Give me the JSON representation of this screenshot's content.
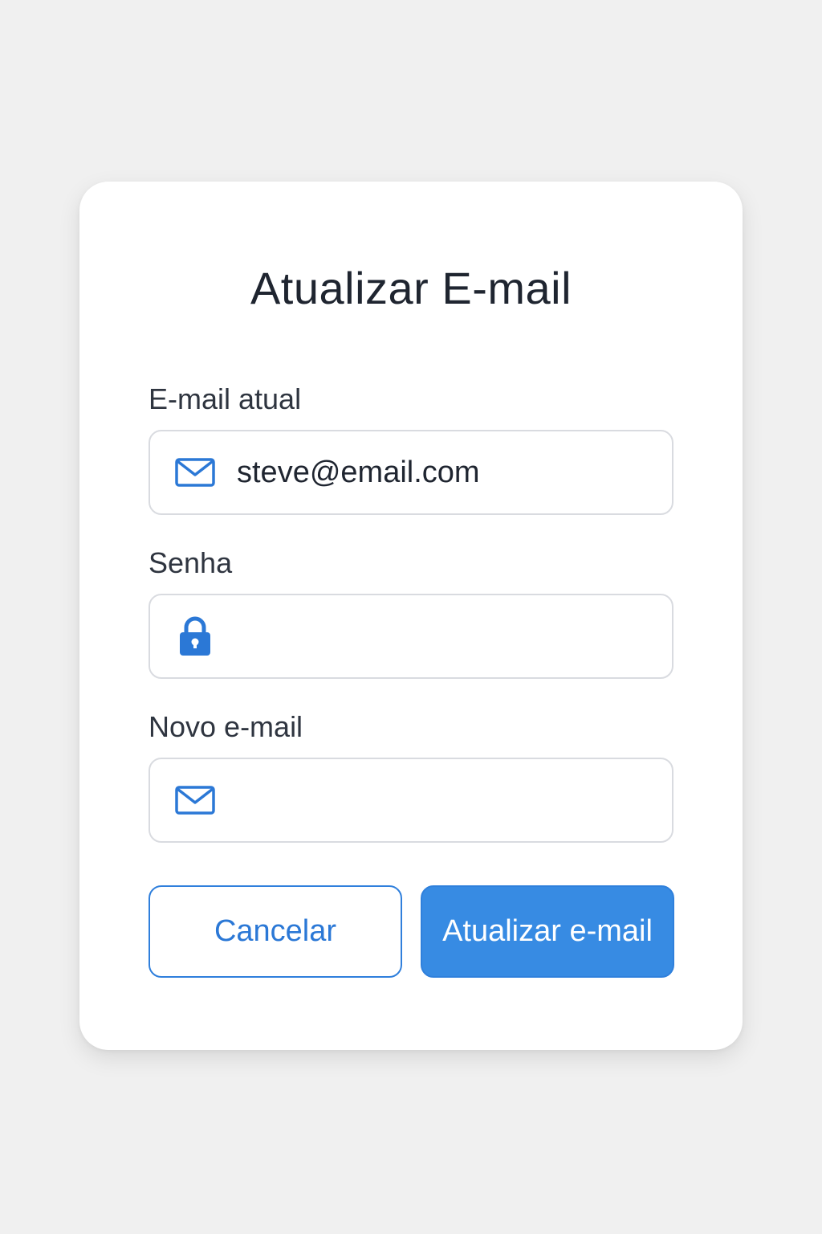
{
  "dialog": {
    "title": "Atualizar E-mail"
  },
  "fields": {
    "current_email": {
      "label": "E-mail atual",
      "value": "steve@email.com",
      "icon": "mail-icon"
    },
    "password": {
      "label": "Senha",
      "value": "",
      "icon": "lock-icon"
    },
    "new_email": {
      "label": "Novo e-mail",
      "value": "",
      "icon": "mail-icon"
    }
  },
  "buttons": {
    "cancel_label": "Cancelar",
    "submit_label": "Atualizar e-mail"
  },
  "colors": {
    "accent": "#378be3",
    "icon": "#2b78d6",
    "background": "#f0f0f0"
  }
}
